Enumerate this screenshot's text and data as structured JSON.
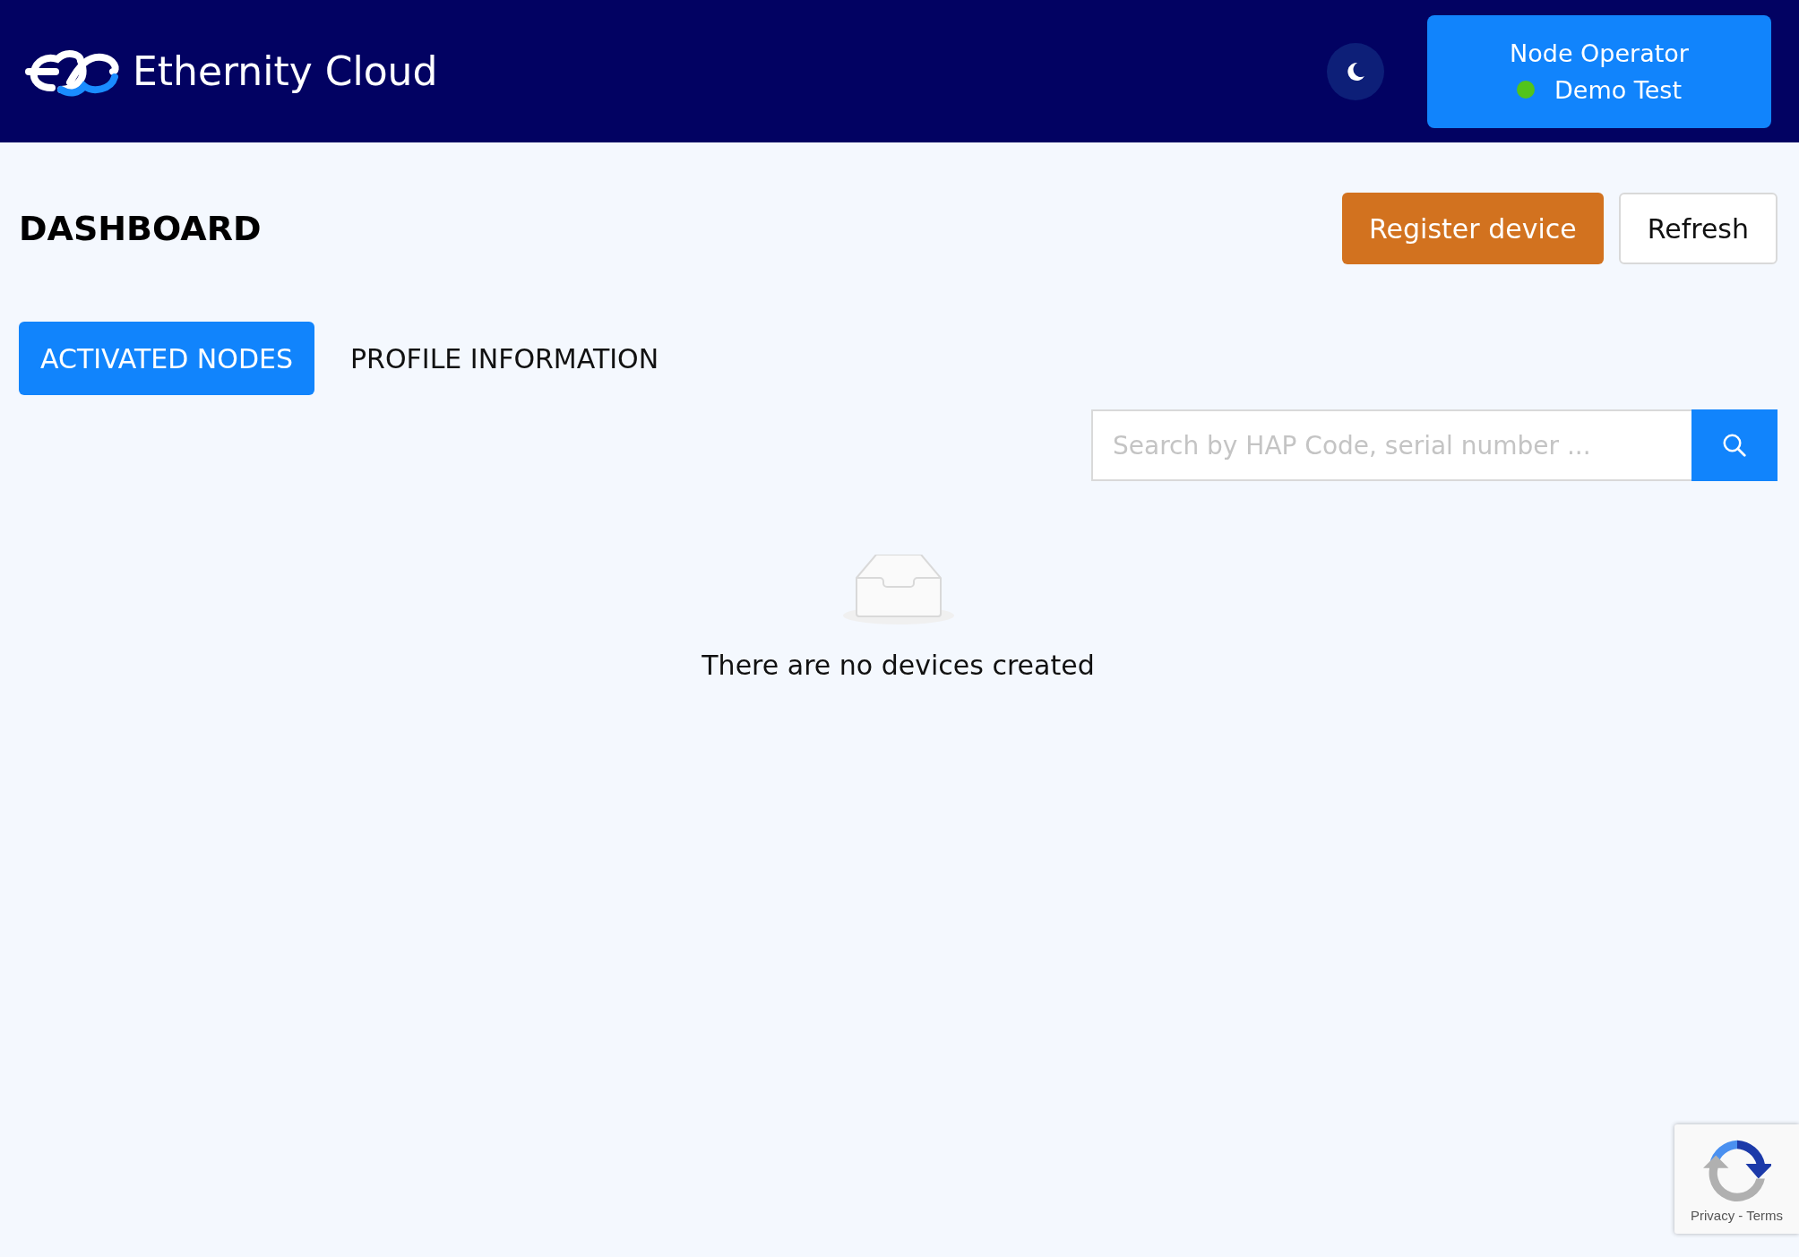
{
  "header": {
    "brand": "Ethernity Cloud",
    "user": {
      "role": "Node Operator",
      "name": "Demo Test",
      "online": true
    }
  },
  "page": {
    "title": "DASHBOARD",
    "actions": [
      {
        "label": "Register device",
        "kind": "primary"
      },
      {
        "label": "Refresh",
        "kind": "default"
      }
    ]
  },
  "tabs": [
    {
      "label": "ACTIVATED NODES",
      "selected": true
    },
    {
      "label": "PROFILE INFORMATION",
      "selected": false
    }
  ],
  "search": {
    "placeholder": "Search by HAP Code, serial number ..."
  },
  "empty_state": {
    "message": "There are no devices created"
  },
  "recaptcha": {
    "links": [
      "Privacy",
      "Terms"
    ],
    "separator": "-"
  }
}
